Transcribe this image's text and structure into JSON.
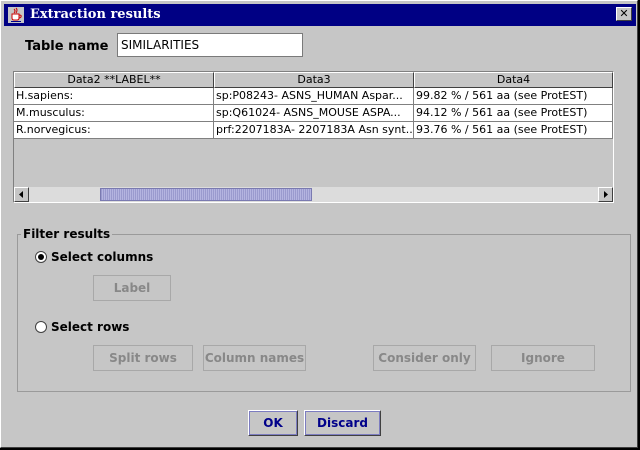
{
  "window": {
    "title": "Extraction results",
    "close_glyph": "✕",
    "app_icon": "java-cup-icon"
  },
  "table_name": {
    "label": "Table name",
    "value": "SIMILARITIES"
  },
  "table": {
    "columns": [
      "Data2  **LABEL**",
      "Data3",
      "Data4"
    ],
    "rows": [
      [
        "H.sapiens:",
        "sp:P08243- ASNS_HUMAN Aspar...",
        "99.82 % / 561 aa (see ProtEST)"
      ],
      [
        "M.musculus:",
        "sp:Q61024- ASNS_MOUSE ASPA...",
        "94.12 % / 561 aa (see ProtEST)"
      ],
      [
        "R.norvegicus:",
        "prf:2207183A- 2207183A Asn synt...",
        "93.76 % / 561 aa (see ProtEST)"
      ]
    ]
  },
  "filter": {
    "title": "Filter results",
    "select_columns": {
      "label": "Select columns",
      "selected": true,
      "label_button": "Label"
    },
    "select_rows": {
      "label": "Select rows",
      "selected": false,
      "buttons": {
        "split_rows": "Split rows",
        "column_names": "Column names",
        "consider_only": "Consider only",
        "ignore": "Ignore"
      }
    }
  },
  "actions": {
    "ok": "OK",
    "discard": "Discard"
  }
}
